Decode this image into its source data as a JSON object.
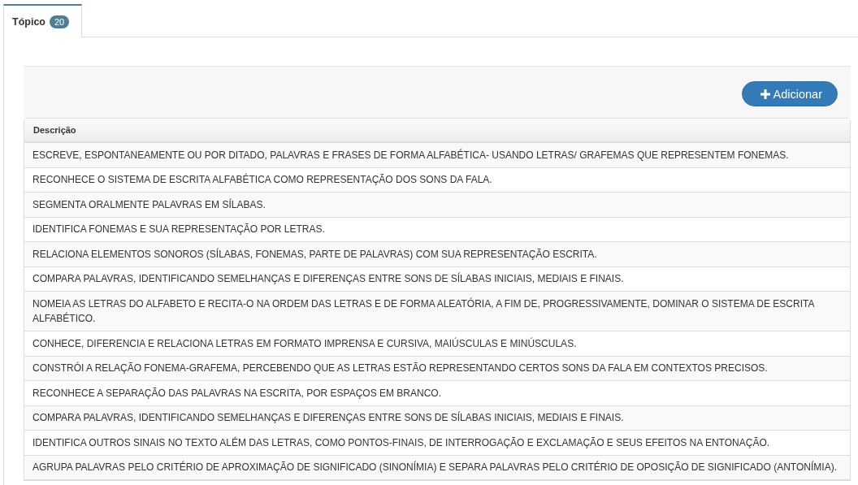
{
  "tabs": [
    {
      "label": "Tópico",
      "count": "20",
      "selected": true
    }
  ],
  "toolbar": {
    "add_button": "Adicionar"
  },
  "table": {
    "columns": [
      "Descrição"
    ],
    "rows": [
      "ESCREVE, ESPONTANEAMENTE OU POR DITADO, PALAVRAS E FRASES DE FORMA ALFABÉTICA- USANDO LETRAS/ GRAFEMAS QUE REPRESENTEM FONEMAS.",
      "RECONHECE O SISTEMA DE ESCRITA ALFABÉTICA COMO REPRESENTAÇÃO DOS SONS DA FALA.",
      "SEGMENTA ORALMENTE PALAVRAS EM SÍLABAS.",
      "IDENTIFICA FONEMAS E SUA REPRESENTAÇÃO POR LETRAS.",
      "RELACIONA ELEMENTOS SONOROS (SÍLABAS, FONEMAS, PARTE DE PALAVRAS) COM SUA REPRESENTAÇÃO ESCRITA.",
      "COMPARA PALAVRAS, IDENTIFICANDO SEMELHANÇAS E DIFERENÇAS ENTRE SONS DE SÍLABAS INICIAIS, MEDIAIS E FINAIS.",
      "NOMEIA AS LETRAS DO ALFABETO E RECITA-O NA ORDEM DAS LETRAS E DE FORMA ALEATÓRIA, A FIM DE, PROGRESSIVAMENTE, DOMINAR O SISTEMA DE ESCRITA ALFABÉTICO.",
      "CONHECE, DIFERENCIA E RELACIONA LETRAS EM FORMATO IMPRENSA E CURSIVA, MAIÚSCULAS E MINÚSCULAS.",
      "CONSTRÓI A RELAÇÃO FONEMA-GRAFEMA, PERCEBENDO QUE AS LETRAS ESTÃO REPRESENTANDO CERTOS SONS DA FALA EM CONTEXTOS PRECISOS.",
      "RECONHECE A SEPARAÇÃO DAS PALAVRAS NA ESCRITA, POR ESPAÇOS EM BRANCO.",
      "COMPARA PALAVRAS, IDENTIFICANDO SEMELHANÇAS E DIFERENÇAS ENTRE SONS DE SÍLABAS INICIAIS, MEDIAIS E FINAIS.",
      "IDENTIFICA OUTROS SINAIS NO TEXTO ALÉM DAS LETRAS, COMO PONTOS-FINAIS, DE INTERROGAÇÃO E EXCLAMAÇÃO E SEUS EFEITOS NA ENTONAÇÃO.",
      "AGRUPA PALAVRAS PELO CRITÉRIO DE APROXIMAÇÃO DE SIGNIFICADO (SINONÍMIA) E SEPARA PALAVRAS PELO CRITÉRIO DE OPOSIÇÃO DE SIGNIFICADO (ANTONÍMIA)."
    ]
  }
}
